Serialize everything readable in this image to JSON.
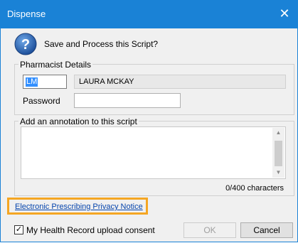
{
  "window": {
    "title": "Dispense",
    "close_glyph": "✕"
  },
  "prompt": {
    "text": "Save and Process this Script?",
    "icon": "question-icon"
  },
  "pharmacist": {
    "legend": "Pharmacist Details",
    "initials_value": "LM",
    "name_value": "LAURA MCKAY",
    "password_label": "Password",
    "password_value": ""
  },
  "annotation": {
    "legend": "Add an annotation to this script",
    "value": "",
    "counter": "0/400 characters"
  },
  "privacy_link": "Electronic Prescribing Privacy Notice",
  "consent": {
    "label": "My Health Record upload consent",
    "checked": true,
    "check_glyph": "✓"
  },
  "buttons": {
    "ok": "OK",
    "cancel": "Cancel"
  },
  "colors": {
    "titlebar": "#1a82d6",
    "highlight_border": "#f5a623",
    "link": "#0645ad"
  }
}
